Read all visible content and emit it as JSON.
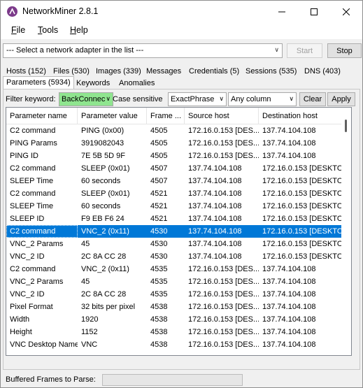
{
  "window": {
    "title": "NetworkMiner 2.8.1"
  },
  "menu": [
    {
      "key": "F",
      "rest": "ile"
    },
    {
      "key": "T",
      "rest": "ools"
    },
    {
      "key": "H",
      "rest": "elp"
    }
  ],
  "adapter": {
    "value": "--- Select a network adapter in the list ---"
  },
  "buttons": {
    "start": "Start",
    "stop": "Stop",
    "clear": "Clear",
    "apply": "Apply"
  },
  "tabs": [
    "Hosts (152)",
    "Files (530)",
    "Images (339)",
    "Messages",
    "Credentials (5)",
    "Sessions (535)",
    "DNS (403)"
  ],
  "subtabs": [
    "Parameters (5934)",
    "Keywords",
    "Anomalies"
  ],
  "filter": {
    "label": "Filter keyword:",
    "keyword": "BackConnec",
    "case_sensitive": "Case sensitive",
    "mode": "ExactPhrase",
    "column": "Any column"
  },
  "columns": [
    "Parameter name",
    "Parameter value",
    "Frame ...",
    "Source host",
    "Destination host"
  ],
  "rows": [
    [
      "C2 command",
      "PING (0x00)",
      "4505",
      "172.16.0.153 [DES...",
      "137.74.104.108"
    ],
    [
      "PING Params",
      "3919082043",
      "4505",
      "172.16.0.153 [DES...",
      "137.74.104.108"
    ],
    [
      "PING ID",
      "7E 5B 5D 9F",
      "4505",
      "172.16.0.153 [DES...",
      "137.74.104.108"
    ],
    [
      "C2 command",
      "SLEEP (0x01)",
      "4507",
      "137.74.104.108",
      "172.16.0.153 [DESKTO"
    ],
    [
      "SLEEP Time",
      "60 seconds",
      "4507",
      "137.74.104.108",
      "172.16.0.153 [DESKTO"
    ],
    [
      "C2 command",
      "SLEEP (0x01)",
      "4521",
      "137.74.104.108",
      "172.16.0.153 [DESKTO"
    ],
    [
      "SLEEP Time",
      "60 seconds",
      "4521",
      "137.74.104.108",
      "172.16.0.153 [DESKTO"
    ],
    [
      "SLEEP ID",
      "F9 EB F6 24",
      "4521",
      "137.74.104.108",
      "172.16.0.153 [DESKTO"
    ],
    [
      "C2 command",
      "VNC_2 (0x11)",
      "4530",
      "137.74.104.108",
      "172.16.0.153 [DESKTO"
    ],
    [
      "VNC_2 Params",
      "45",
      "4530",
      "137.74.104.108",
      "172.16.0.153 [DESKTO"
    ],
    [
      "VNC_2 ID",
      "2C 8A CC 28",
      "4530",
      "137.74.104.108",
      "172.16.0.153 [DESKTO"
    ],
    [
      "C2 command",
      "VNC_2 (0x11)",
      "4535",
      "172.16.0.153 [DES...",
      "137.74.104.108"
    ],
    [
      "VNC_2 Params",
      "45",
      "4535",
      "172.16.0.153 [DES...",
      "137.74.104.108"
    ],
    [
      "VNC_2 ID",
      "2C 8A CC 28",
      "4535",
      "172.16.0.153 [DES...",
      "137.74.104.108"
    ],
    [
      "Pixel Format",
      "32 bits per pixel",
      "4538",
      "172.16.0.153 [DES...",
      "137.74.104.108"
    ],
    [
      "Width",
      "1920",
      "4538",
      "172.16.0.153 [DES...",
      "137.74.104.108"
    ],
    [
      "Height",
      "1152",
      "4538",
      "172.16.0.153 [DES...",
      "137.74.104.108"
    ],
    [
      "VNC Desktop Name",
      "VNC",
      "4538",
      "172.16.0.153 [DES...",
      "137.74.104.108"
    ]
  ],
  "selected_row": 8,
  "status": {
    "label": "Buffered Frames to Parse:",
    "progress": 0
  },
  "colors": {
    "selection": "#0078d7",
    "keyword_highlight": "#8fe58f",
    "app_icon": "#7c3a8a"
  }
}
